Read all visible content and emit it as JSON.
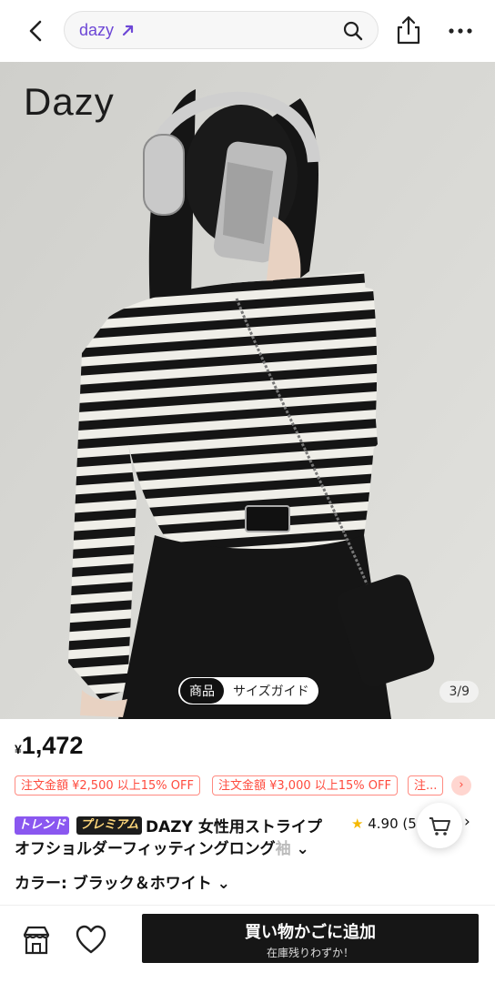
{
  "search": {
    "query": "dazy"
  },
  "hero": {
    "brand": "Dazy",
    "tabs": [
      "商品",
      "サイズガイド"
    ],
    "counter": "3/9"
  },
  "product": {
    "currency": "¥",
    "price": "1,472",
    "coupons": [
      "注文金額 ¥2,500 以上15% OFF",
      "注文金額 ¥3,000 以上15% OFF",
      "注..."
    ],
    "tags": [
      "トレンド",
      "プレミアム"
    ],
    "title_line1": "DAZY 女性用ストライプ",
    "title_line2": "オフショルダーフィッティングロング",
    "title_fade": "袖",
    "rating": "4.90 (5",
    "color_label": "カラー: ブラック＆ホワイト"
  },
  "bottom": {
    "add_to_cart": "買い物かごに追加",
    "stock_note": "在庫残りわずか！"
  },
  "colors": {
    "accent": "#6d47d6",
    "coupon": "#ff4a3d",
    "button": "#161616",
    "star": "#f5b800"
  }
}
